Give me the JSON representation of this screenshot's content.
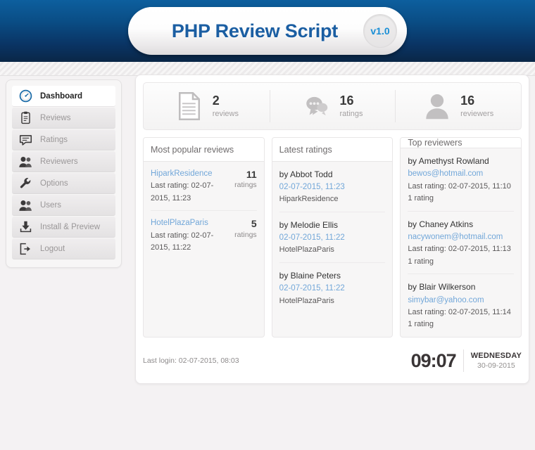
{
  "header": {
    "title": "PHP Review Script",
    "version": "v1.0"
  },
  "sidebar": {
    "items": [
      {
        "label": "Dashboard",
        "icon": "gauge-icon",
        "active": true
      },
      {
        "label": "Reviews",
        "icon": "clipboard-icon",
        "active": false
      },
      {
        "label": "Ratings",
        "icon": "speech-bubble-icon",
        "active": false
      },
      {
        "label": "Reviewers",
        "icon": "users-icon",
        "active": false
      },
      {
        "label": "Options",
        "icon": "wrench-icon",
        "active": false
      },
      {
        "label": "Users",
        "icon": "users-icon",
        "active": false
      },
      {
        "label": "Install & Preview",
        "icon": "download-icon",
        "active": false
      },
      {
        "label": "Logout",
        "icon": "logout-icon",
        "active": false
      }
    ]
  },
  "stats": [
    {
      "value": "2",
      "label": "reviews",
      "icon": "document-icon"
    },
    {
      "value": "16",
      "label": "ratings",
      "icon": "speech-bubble-icon"
    },
    {
      "value": "16",
      "label": "reviewers",
      "icon": "person-icon"
    }
  ],
  "panels": {
    "popular": {
      "title": "Most popular reviews",
      "rows": [
        {
          "name": "HiparkResidence",
          "meta": "Last rating: 02-07-2015, 11:23",
          "count": "11",
          "count_label": "ratings"
        },
        {
          "name": "HotelPlazaParis",
          "meta": "Last rating: 02-07-2015, 11:22",
          "count": "5",
          "count_label": "ratings"
        }
      ]
    },
    "latest": {
      "title": "Latest ratings",
      "rows": [
        {
          "by": "by Abbot Todd",
          "date": "02-07-2015, 11:23",
          "item": "HiparkResidence"
        },
        {
          "by": "by Melodie Ellis",
          "date": "02-07-2015, 11:22",
          "item": "HotelPlazaParis"
        },
        {
          "by": "by Blaine Peters",
          "date": "02-07-2015, 11:22",
          "item": "HotelPlazaParis"
        }
      ]
    },
    "top": {
      "title": "Top reviewers",
      "rows": [
        {
          "by": "by Amethyst Rowland",
          "email": "bewos@hotmail.com",
          "last": "Last rating: 02-07-2015, 11:10",
          "count": "1 rating"
        },
        {
          "by": "by Chaney Atkins",
          "email": "nacywonem@hotmail.com",
          "last": "Last rating: 02-07-2015, 11:13",
          "count": "1 rating"
        },
        {
          "by": "by Blair Wilkerson",
          "email": "simybar@yahoo.com",
          "last": "Last rating: 02-07-2015, 11:14",
          "count": "1 rating"
        }
      ]
    }
  },
  "footer": {
    "last_login": "Last login: 02-07-2015, 08:03",
    "time": "09:07",
    "day_of_week": "WEDNESDAY",
    "date": "30-09-2015"
  },
  "colors": {
    "header_blue_top": "#0d5f9e",
    "header_blue_bottom": "#0a2747",
    "title_blue": "#1b5ea2",
    "version_blue": "#1a8fd6",
    "link_blue": "#72a7d9",
    "page_bg": "#f4f2f3"
  }
}
